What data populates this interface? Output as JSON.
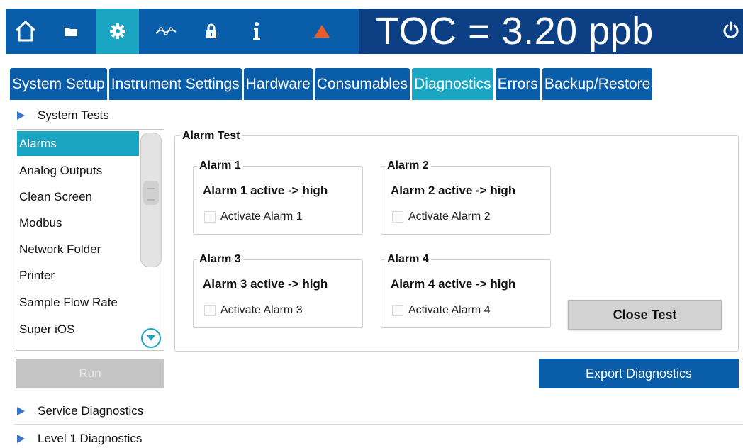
{
  "header": {
    "reading": "TOC = 3.20 ppb",
    "icons": [
      "home-icon",
      "folder-icon",
      "gear-icon",
      "trend-icon",
      "lock-icon",
      "info-icon",
      "warning-icon",
      "power-icon"
    ],
    "active_icon": "gear-icon"
  },
  "tabs": [
    {
      "label": "System Setup",
      "active": false
    },
    {
      "label": "Instrument Settings",
      "active": false
    },
    {
      "label": "Hardware",
      "active": false
    },
    {
      "label": "Consumables",
      "active": false
    },
    {
      "label": "Diagnostics",
      "active": true
    },
    {
      "label": "Errors",
      "active": false
    },
    {
      "label": "Backup/Restore",
      "active": false
    }
  ],
  "sections": {
    "system_tests": "System Tests",
    "service_diagnostics": "Service Diagnostics",
    "level1_diagnostics": "Level 1 Diagnostics"
  },
  "tests_list": {
    "items": [
      "Alarms",
      "Analog Outputs",
      "Clean Screen",
      "Modbus",
      "Network Folder",
      "Printer",
      "Sample Flow Rate",
      "Super iOS"
    ],
    "selected": "Alarms"
  },
  "run_button": "Run",
  "alarm_test": {
    "title": "Alarm Test",
    "alarms": [
      {
        "title": "Alarm 1",
        "status": "Alarm 1 active -> high",
        "checkbox_label": "Activate Alarm 1",
        "checked": false
      },
      {
        "title": "Alarm 2",
        "status": "Alarm 2 active -> high",
        "checkbox_label": "Activate Alarm 2",
        "checked": false
      },
      {
        "title": "Alarm 3",
        "status": "Alarm 3 active -> high",
        "checkbox_label": "Activate Alarm 3",
        "checked": false
      },
      {
        "title": "Alarm 4",
        "status": "Alarm 4 active -> high",
        "checkbox_label": "Activate Alarm 4",
        "checked": false
      }
    ],
    "close_button": "Close Test"
  },
  "export_button": "Export Diagnostics",
  "colors": {
    "primary_blue": "#0a5da8",
    "dark_blue": "#0d3f85",
    "accent_cyan": "#1aa6c3",
    "warning_orange": "#f05a28"
  }
}
